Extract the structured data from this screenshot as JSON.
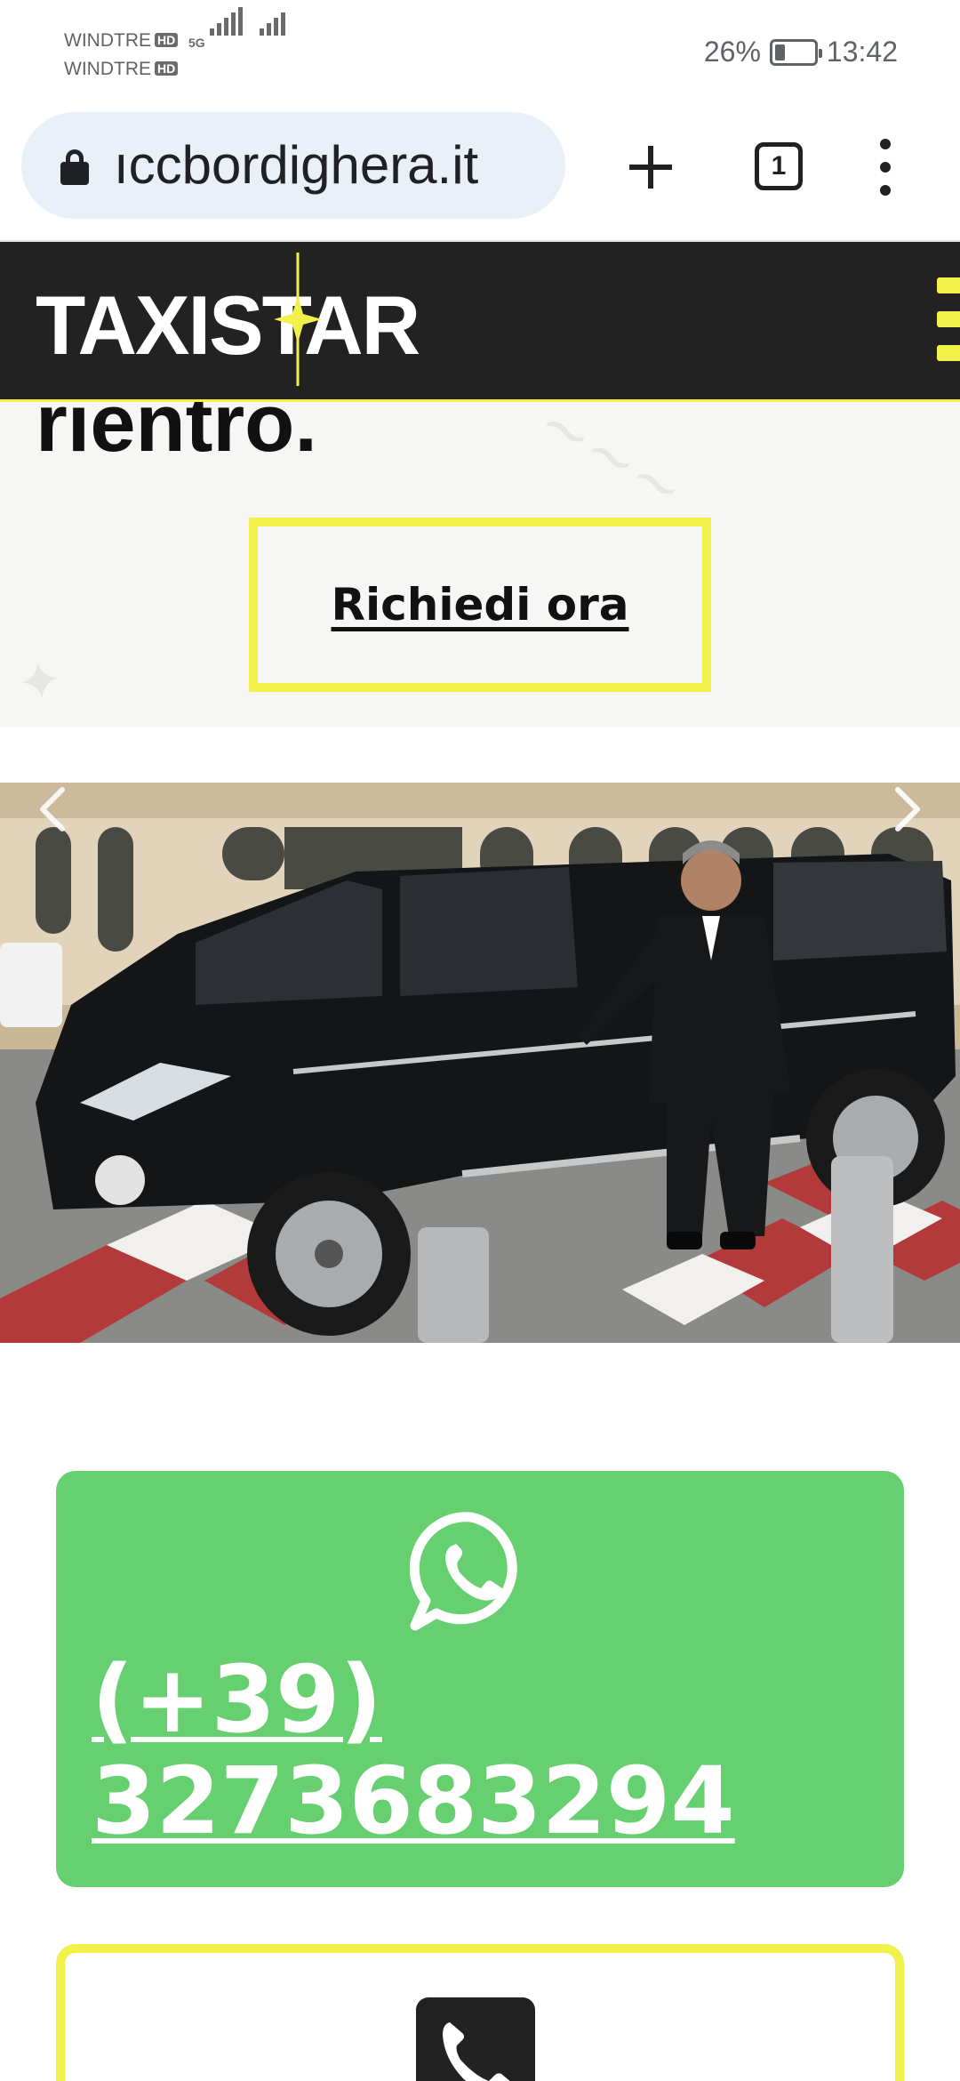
{
  "status_bar": {
    "carrier1": "WINDTRE",
    "carrier2": "WINDTRE",
    "hd_badge": "HD",
    "network": "5G",
    "battery_text": "26%",
    "battery_level": 0.26,
    "time": "13:42"
  },
  "browser": {
    "url_text": "ıccbordighera.it",
    "tab_count": "1",
    "icons": [
      "lock-icon",
      "new-tab-icon",
      "tab-switcher-icon",
      "overflow-menu-icon"
    ]
  },
  "site": {
    "logo": "TAXISTAR",
    "hero_text": "rientro.",
    "cta_label": "Richiedi ora",
    "whatsapp_number": "(+39) 3273683294"
  },
  "colors": {
    "accent_yellow": "#f2f04a",
    "header_dark": "#222222",
    "whatsapp_green": "#66cf6f"
  }
}
